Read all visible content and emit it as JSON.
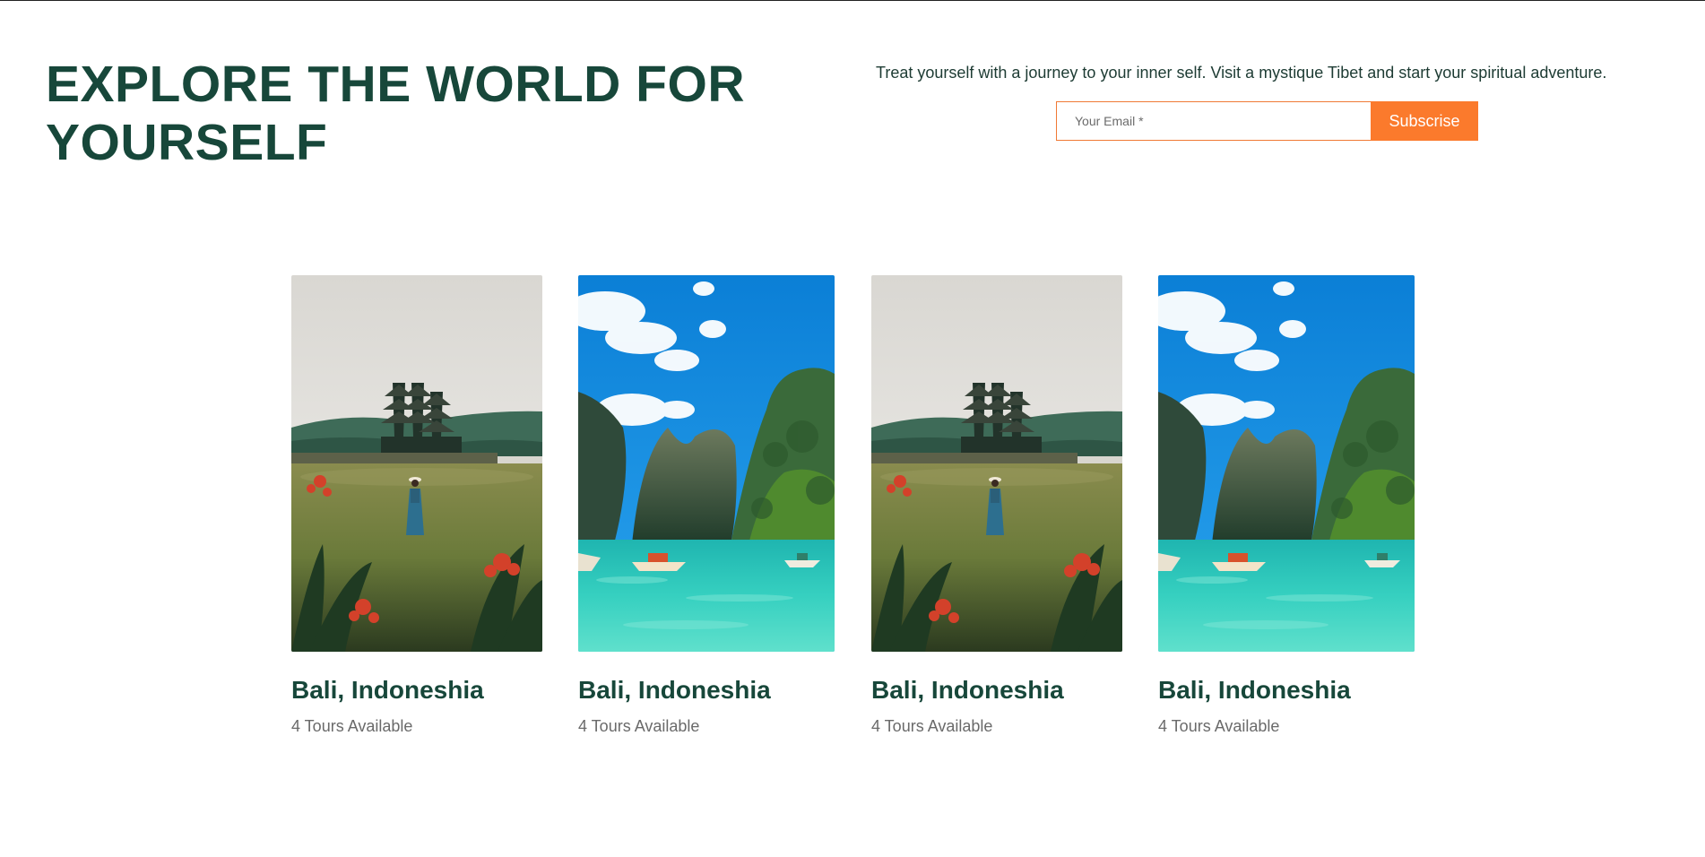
{
  "hero": {
    "title": "EXPLORE THE WORLD FOR YOURSELF",
    "description": "Treat yourself with a journey to your inner self. Visit a mystique Tibet and start your spiritual adventure.",
    "email_placeholder": "Your Email *",
    "subscribe_label": "Subscrise"
  },
  "colors": {
    "heading": "#17473a",
    "accent": "#fb7a2c",
    "muted_text": "#6a6a6a"
  },
  "destinations": [
    {
      "title": "Bali, Indoneshia",
      "subtitle": "4 Tours Available",
      "image": "temple-field-photo"
    },
    {
      "title": "Bali, Indoneshia",
      "subtitle": "4 Tours Available",
      "image": "lagoon-cliffs-photo"
    },
    {
      "title": "Bali, Indoneshia",
      "subtitle": "4 Tours Available",
      "image": "temple-field-photo"
    },
    {
      "title": "Bali, Indoneshia",
      "subtitle": "4 Tours Available",
      "image": "lagoon-cliffs-photo"
    }
  ]
}
